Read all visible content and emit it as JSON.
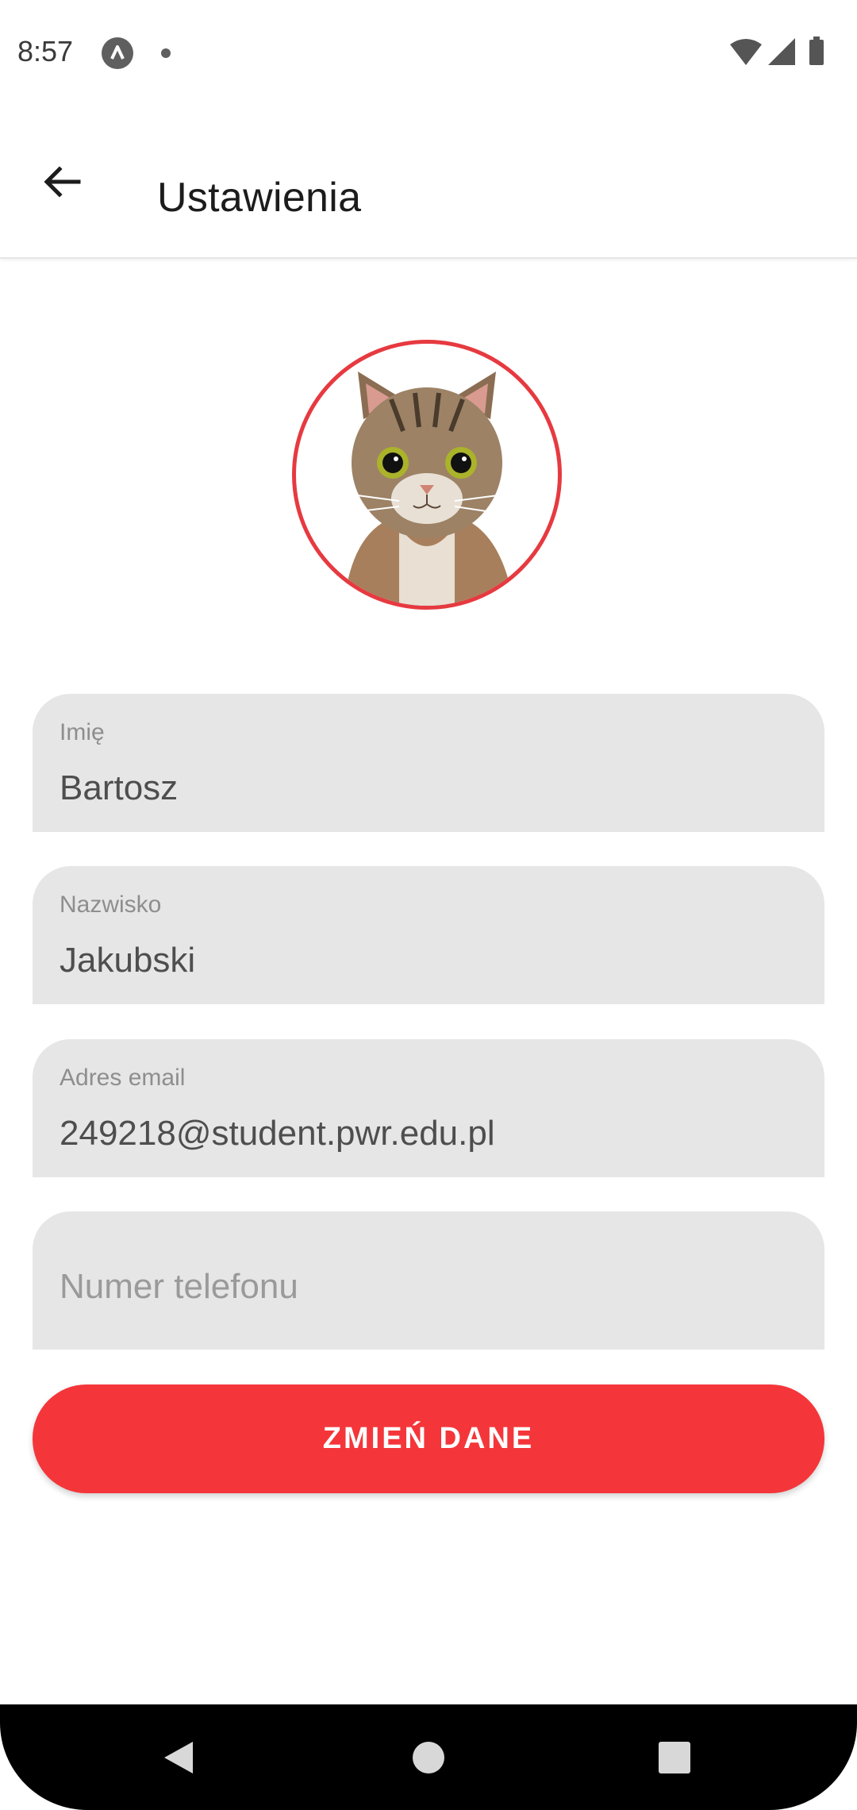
{
  "status_bar": {
    "time": "8:57",
    "icons": [
      "app-notification-icon",
      "dot-icon",
      "wifi-icon",
      "signal-icon",
      "battery-icon"
    ]
  },
  "app_bar": {
    "title": "Ustawienia",
    "back_icon": "arrow-back-icon"
  },
  "profile": {
    "avatar_description_icon": "cat-avatar",
    "ring_color": "#e63a40"
  },
  "form": {
    "first_name": {
      "label": "Imię",
      "value": "Bartosz"
    },
    "last_name": {
      "label": "Nazwisko",
      "value": "Jakubski"
    },
    "email": {
      "label": "Adres email",
      "value": "249218@student.pwr.edu.pl"
    },
    "phone": {
      "placeholder": "Numer telefonu",
      "value": ""
    }
  },
  "submit_button": {
    "label": "ZMIEŃ DANE",
    "color": "#f4363a"
  },
  "nav_bar": {
    "icons": [
      "back-triangle-icon",
      "home-circle-icon",
      "recents-square-icon"
    ]
  }
}
